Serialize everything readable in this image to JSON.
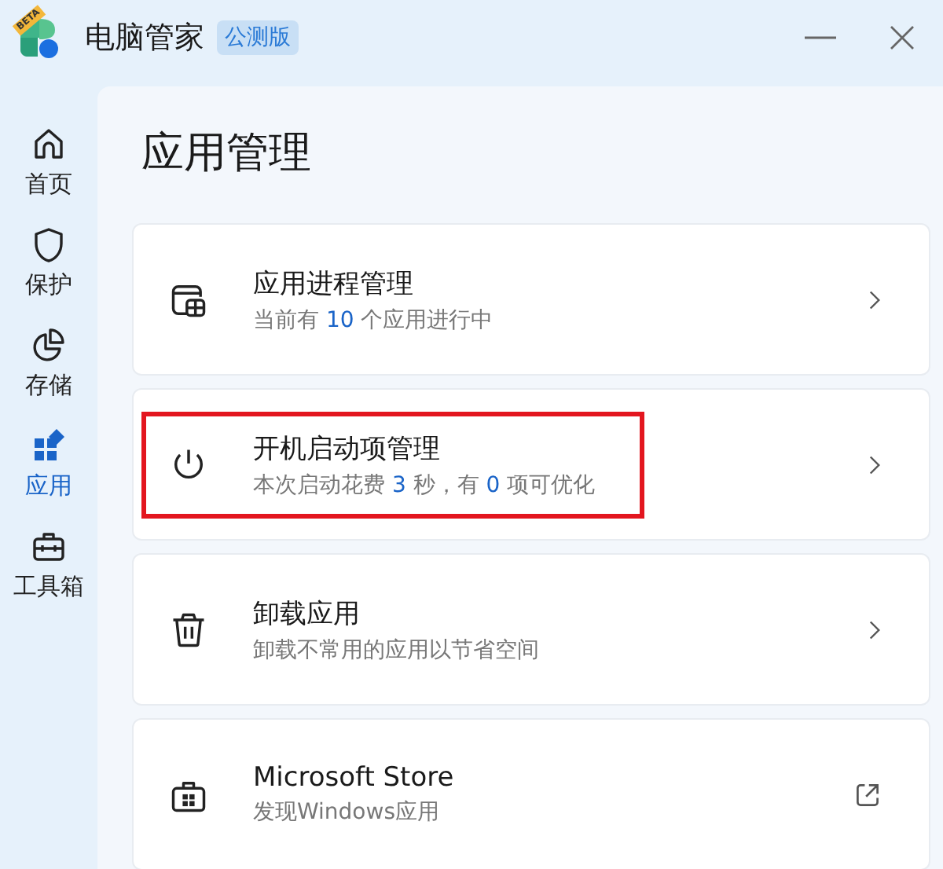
{
  "window": {
    "title": "电脑管家",
    "badge": "公测版",
    "logo_badge": "BETA"
  },
  "sidebar": {
    "items": [
      {
        "label": "首页",
        "selected": false
      },
      {
        "label": "保护",
        "selected": false
      },
      {
        "label": "存储",
        "selected": false
      },
      {
        "label": "应用",
        "selected": true
      },
      {
        "label": "工具箱",
        "selected": false
      }
    ]
  },
  "page": {
    "title": "应用管理"
  },
  "cards": [
    {
      "kind": "navigate",
      "title": "应用进程管理",
      "subtitle": [
        {
          "kind": "text",
          "text": "当前有 "
        },
        {
          "kind": "number",
          "text": "10"
        },
        {
          "kind": "text",
          "text": " 个应用进行中"
        }
      ],
      "highlighted": false
    },
    {
      "kind": "navigate",
      "title": "开机启动项管理",
      "subtitle": [
        {
          "kind": "text",
          "text": "本次启动花费 "
        },
        {
          "kind": "number",
          "text": "3"
        },
        {
          "kind": "text",
          "text": " 秒，有 "
        },
        {
          "kind": "number",
          "text": "0"
        },
        {
          "kind": "text",
          "text": " 项可优化"
        }
      ],
      "highlighted": true
    },
    {
      "kind": "navigate",
      "title": "卸载应用",
      "subtitle": [
        {
          "kind": "text",
          "text": "卸载不常用的应用以节省空间"
        }
      ],
      "highlighted": false
    },
    {
      "kind": "external",
      "title": "Microsoft Store",
      "subtitle": [
        {
          "kind": "text",
          "text": "发现Windows应用"
        }
      ],
      "highlighted": false
    }
  ]
}
